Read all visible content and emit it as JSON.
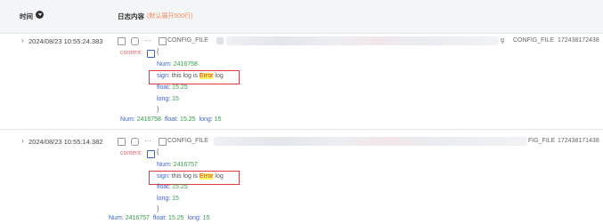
{
  "header": {
    "time_label": "时间",
    "log_label": "日志内容",
    "log_note": "(默认展开500行)"
  },
  "rows": [
    {
      "timestamp": "2024/08/23 10:55:24.383",
      "config_tag": "CONFIG_FILE",
      "trail_g": "g",
      "col_config": "CONFIG_FILE",
      "col_id": "172438172438",
      "content_key": "content:",
      "num_key": "Num",
      "num_val": "2416758",
      "sign_key": "sign",
      "sign_pre": "this log is ",
      "sign_hl": "Error",
      "sign_post": " log",
      "float_key": "float",
      "float_val": "15.25",
      "long_key": "long",
      "long_val": "15",
      "summary_num_key": "Num:",
      "summary_num": "2416758",
      "summary_float_key": "float:",
      "summary_float": "15.25",
      "summary_long_key": "long:",
      "summary_long": "15"
    },
    {
      "timestamp": "2024/08/23 10:55:14.382",
      "config_tag": "CONFIG_FILE",
      "col_config": "FIG_FILE",
      "col_id": "172438171438",
      "content_key": "content:",
      "num_key": "Num",
      "num_val": "2416757",
      "sign_key": "sign",
      "sign_pre": "this log is ",
      "sign_hl": "Error",
      "sign_post": " log",
      "float_key": "float",
      "float_val": "15.25",
      "long_key": "long",
      "long_val": "15",
      "summary_num_key": "Num:",
      "summary_num": "2416757",
      "summary_float_key": "float:",
      "summary_float": "15.25",
      "summary_long_key": "long:",
      "summary_long": "15"
    }
  ],
  "icons": {
    "chevron": "›",
    "ellipsis": "···",
    "brace_open": "{",
    "brace_close": "}",
    "colon": ":"
  }
}
